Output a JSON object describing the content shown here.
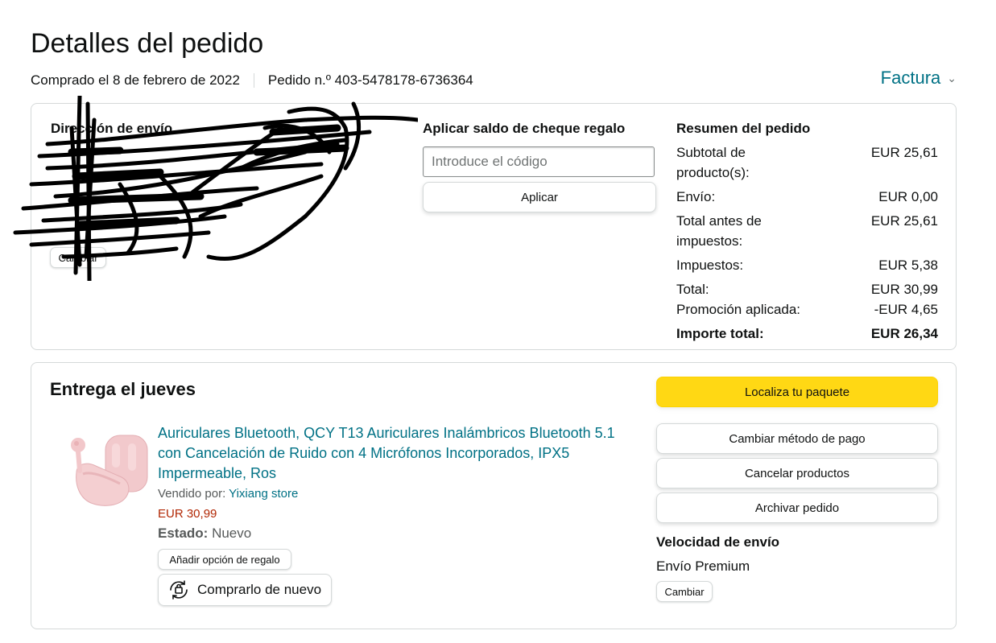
{
  "header": {
    "title": "Detalles del pedido",
    "purchase_date": "Comprado el 8 de febrero de 2022",
    "order_number": "Pedido n.º 403-5478178-6736364",
    "invoice_label": "Factura"
  },
  "shipping": {
    "title": "Dirección de envío",
    "change_label": "Cambiar"
  },
  "gift_card": {
    "title": "Aplicar saldo de cheque regalo",
    "placeholder": "Introduce el código",
    "apply_label": "Aplicar"
  },
  "summary": {
    "title": "Resumen del pedido",
    "rows": [
      {
        "label": "Subtotal de producto(s):",
        "value": "EUR 25,61"
      },
      {
        "label": "Envío:",
        "value": "EUR 0,00"
      },
      {
        "label": "Total antes de impuestos:",
        "value": "EUR 25,61"
      },
      {
        "label": "Impuestos:",
        "value": "EUR 5,38"
      },
      {
        "label": "Total:",
        "value": "EUR 30,99"
      },
      {
        "label": "Promoción aplicada:",
        "value": "-EUR 4,65"
      },
      {
        "label": "Importe total:",
        "value": "EUR 26,34"
      }
    ]
  },
  "delivery": {
    "title": "Entrega el jueves",
    "product": {
      "name": "Auriculares Bluetooth, QCY T13 Auriculares Inalámbricos Bluetooth 5.1 con Cancelación de Ruido con 4 Micrófonos Incorporados, IPX5 Impermeable, Ros",
      "sold_by_label": "Vendido por:",
      "seller": "Yixiang store",
      "price": "EUR 30,99",
      "state_label": "Estado:",
      "state_value": "Nuevo",
      "gift_option_label": "Añadir opción de regalo",
      "buy_again_label": "Comprarlo de nuevo"
    },
    "actions": {
      "track": "Localiza tu paquete",
      "change_payment": "Cambiar método de pago",
      "cancel": "Cancelar productos",
      "archive": "Archivar pedido"
    },
    "speed": {
      "title": "Velocidad de envío",
      "value": "Envío Premium",
      "change_label": "Cambiar"
    }
  },
  "colors": {
    "link": "#007185",
    "price": "#B12704",
    "primary_button": "#FFD814",
    "border": "#D5D9D9"
  }
}
